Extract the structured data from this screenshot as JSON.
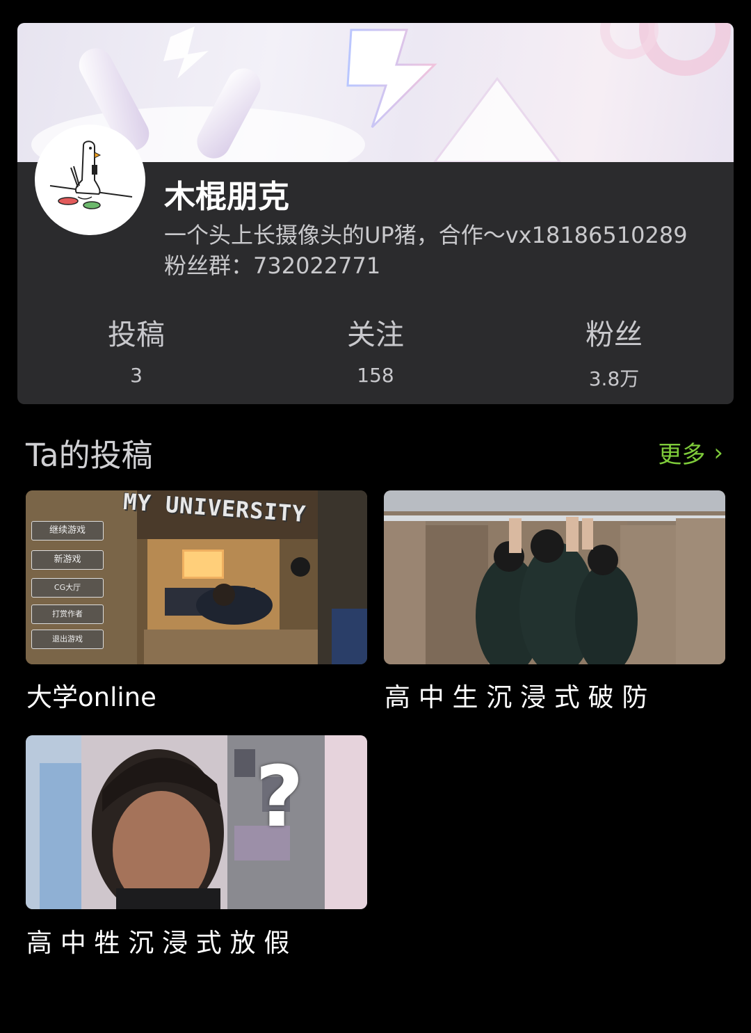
{
  "profile": {
    "username": "木棍朋克",
    "bio_line1": "一个头上长摄像头的UP猪，合作～vx18186510289",
    "bio_line2": "粉丝群：732022771"
  },
  "stats": [
    {
      "label": "投稿",
      "value": "3"
    },
    {
      "label": "关注",
      "value": "158"
    },
    {
      "label": "粉丝",
      "value": "3.8万"
    }
  ],
  "section": {
    "title": "Ta的投稿",
    "more_label": "更多",
    "more_icon": "chevron-right-icon"
  },
  "videos": [
    {
      "title": "大学online",
      "thumb_text": "MY UNIVERSITY",
      "menu": [
        "继续游戏",
        "新游戏",
        "CG大厅",
        "打赏作者",
        "退出游戏"
      ]
    },
    {
      "title": "高 中 生 沉 浸 式 破 防"
    },
    {
      "title": "高 中 牲 沉 浸 式 放 假",
      "thumb_text": "?"
    }
  ],
  "colors": {
    "background": "#000000",
    "card": "#2b2b2d",
    "accent_green": "#7ecb3a"
  }
}
